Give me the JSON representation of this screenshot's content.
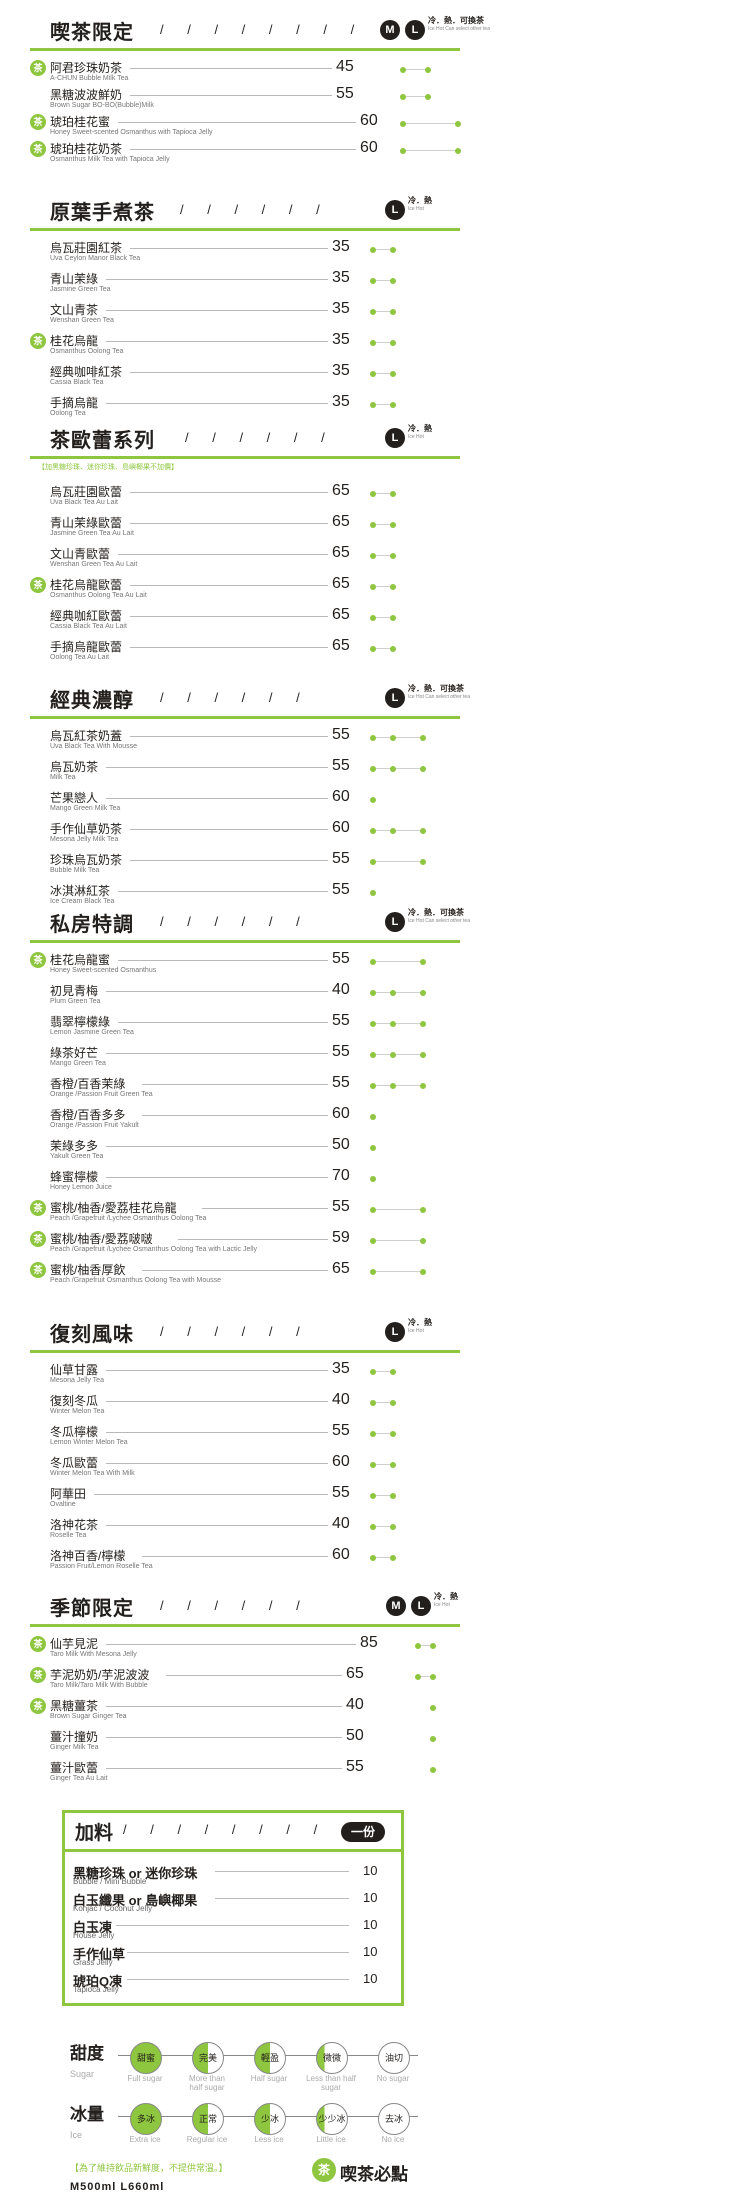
{
  "sections": {
    "s1": {
      "title": "喫茶限定",
      "sizes": [
        "M",
        "L"
      ],
      "temp": "冷．熱．可換茶",
      "temp_sub": "Ice   Hot   Can select other tea",
      "items": [
        {
          "name": "阿君珍珠奶茶",
          "en": "A-CHUN Bubble Milk Tea",
          "price": "45",
          "rec": true
        },
        {
          "name": "黑糖波波鮮奶",
          "en": "Brown Sugar BO-BO(Bubble)Milk",
          "price": "55",
          "rec": false
        },
        {
          "name": "琥珀桂花蜜",
          "en": "Honey Sweet-scented Osmanthus with Tapioca Jelly",
          "price": "60",
          "rec": true
        },
        {
          "name": "琥珀桂花奶茶",
          "en": "Osmanthus Milk Tea with Tapioca Jelly",
          "price": "60",
          "rec": true
        }
      ]
    },
    "s2": {
      "title": "原葉手煮茶",
      "sizes": [
        "L"
      ],
      "temp": "冷．熱",
      "temp_sub": "Ice   Hot",
      "items": [
        {
          "name": "烏瓦莊園紅茶",
          "en": "Uva Ceylon Manor Black Tea",
          "price": "35",
          "rec": false
        },
        {
          "name": "青山茉綠",
          "en": "Jasmine Green Tea",
          "price": "35",
          "rec": false
        },
        {
          "name": "文山青茶",
          "en": "Wenshan Green Tea",
          "price": "35",
          "rec": false
        },
        {
          "name": "桂花烏龍",
          "en": "Osmanthus Oolong Tea",
          "price": "35",
          "rec": true
        },
        {
          "name": "經典咖啡紅茶",
          "en": "Cassia Black Tea",
          "price": "35",
          "rec": false
        },
        {
          "name": "手摘烏龍",
          "en": "Oolong Tea",
          "price": "35",
          "rec": false
        }
      ]
    },
    "s3": {
      "title": "茶歐蕾系列",
      "sizes": [
        "L"
      ],
      "temp": "冷．熱",
      "temp_sub": "Ice   Hot",
      "note": "【加黑糖珍珠、迷你珍珠、島嶼椰果不加價】",
      "items": [
        {
          "name": "烏瓦莊園歐蕾",
          "en": "Uva Black Tea Au Lait",
          "price": "65",
          "rec": false
        },
        {
          "name": "青山茉綠歐蕾",
          "en": "Jasmine Green Tea Au Lait",
          "price": "65",
          "rec": false
        },
        {
          "name": "文山青歐蕾",
          "en": "Wenshan Green Tea Au Lait",
          "price": "65",
          "rec": false
        },
        {
          "name": "桂花烏龍歐蕾",
          "en": "Osmanthus Oolong Tea Au Lait",
          "price": "65",
          "rec": true
        },
        {
          "name": "經典咖紅歐蕾",
          "en": "Cassia Black Tea Au Lait",
          "price": "65",
          "rec": false
        },
        {
          "name": "手摘烏龍歐蕾",
          "en": "Oolong Tea Au Lait",
          "price": "65",
          "rec": false
        }
      ]
    },
    "s4": {
      "title": "經典濃醇",
      "sizes": [
        "L"
      ],
      "temp": "冷．熱．可換茶",
      "temp_sub": "Ice   Hot   Can select other tea",
      "items": [
        {
          "name": "烏瓦紅茶奶蓋",
          "en": "Uva Black Tea With Mousse",
          "price": "55",
          "rec": false
        },
        {
          "name": "烏瓦奶茶",
          "en": "Milk Tea",
          "price": "55",
          "rec": false
        },
        {
          "name": "芒果戀人",
          "en": "Mango Green Milk Tea",
          "price": "60",
          "rec": false
        },
        {
          "name": "手作仙草奶茶",
          "en": "Mesona Jelly Milk Tea",
          "price": "60",
          "rec": false
        },
        {
          "name": "珍珠烏瓦奶茶",
          "en": "Bubble Milk Tea",
          "price": "55",
          "rec": false
        },
        {
          "name": "冰淇淋紅茶",
          "en": "Ice Cream Black Tea",
          "price": "55",
          "rec": false
        }
      ]
    },
    "s5": {
      "title": "私房特調",
      "sizes": [
        "L"
      ],
      "temp": "冷．熱．可換茶",
      "temp_sub": "Ice   Hot   Can select other tea",
      "items": [
        {
          "name": "桂花烏龍蜜",
          "en": "Honey Sweet-scented Osmanthus",
          "price": "55",
          "rec": true
        },
        {
          "name": "初見青梅",
          "en": "Plum Green Tea",
          "price": "40",
          "rec": false
        },
        {
          "name": "翡翠檸檬綠",
          "en": "Lemon Jasmine Green Tea",
          "price": "55",
          "rec": false
        },
        {
          "name": "綠茶好芒",
          "en": "Mango Green Tea",
          "price": "55",
          "rec": false
        },
        {
          "name": "香橙/百香茉綠",
          "en": "Orange /Passion Fruit Green Tea",
          "price": "55",
          "rec": false
        },
        {
          "name": "香橙/百香多多",
          "en": "Orange /Passion Fruit Yakult",
          "price": "60",
          "rec": false
        },
        {
          "name": "茉綠多多",
          "en": "Yakult Green Tea",
          "price": "50",
          "rec": false
        },
        {
          "name": "蜂蜜檸檬",
          "en": "Honey Lemon Juice",
          "price": "70",
          "rec": false
        },
        {
          "name": "蜜桃/柚香/愛荔桂花烏龍",
          "en": "Peach /Grapefruit /Lychee Osmanthus Oolong Tea",
          "price": "55",
          "rec": true
        },
        {
          "name": "蜜桃/柚香/愛荔啵啵",
          "en": "Peach /Grapefruit /Lychee Osmanthus Oolong Tea with Lactic Jelly",
          "price": "59",
          "rec": true
        },
        {
          "name": "蜜桃/柚香厚飲",
          "en": "Peach /Grapefruit Osmanthus Oolong Tea with Mousse",
          "price": "65",
          "rec": true
        }
      ]
    },
    "s6": {
      "title": "復刻風味",
      "sizes": [
        "L"
      ],
      "temp": "冷．熱",
      "temp_sub": "Ice   Hot",
      "items": [
        {
          "name": "仙草甘露",
          "en": "Mesona Jelly Tea",
          "price": "35",
          "rec": false
        },
        {
          "name": "復刻冬瓜",
          "en": "Winter Melon Tea",
          "price": "40",
          "rec": false
        },
        {
          "name": "冬瓜檸檬",
          "en": "Lemon Winter Melon Tea",
          "price": "55",
          "rec": false
        },
        {
          "name": "冬瓜歐蕾",
          "en": "Winter Melon Tea With Milk",
          "price": "60",
          "rec": false
        },
        {
          "name": "阿華田",
          "en": "Ovaltine",
          "price": "55",
          "rec": false
        },
        {
          "name": "洛神花茶",
          "en": "Roselle Tea",
          "price": "40",
          "rec": false
        },
        {
          "name": "洛神百香/檸檬",
          "en": "Passion Fruit/Lemon Roselle Tea",
          "price": "60",
          "rec": false
        }
      ]
    },
    "s7": {
      "title": "季節限定",
      "sizes": [
        "M",
        "L"
      ],
      "temp": "冷．熱",
      "temp_sub": "Ice   Hot",
      "items": [
        {
          "name": "仙芋見泥",
          "en": "Taro Milk With Mesona Jelly",
          "price": "85",
          "rec": true
        },
        {
          "name": "芋泥奶奶/芋泥波波",
          "en": "Taro Milk/Taro Milk With Bubble",
          "price": "65",
          "rec": true
        },
        {
          "name": "黑糖薑茶",
          "en": "Brown Sugar Ginger Tea",
          "price": "40",
          "rec": true
        },
        {
          "name": "薑汁撞奶",
          "en": "Ginger Milk Tea",
          "price": "50",
          "rec": false
        },
        {
          "name": "薑汁歐蕾",
          "en": "Ginger Tea Au Lait",
          "price": "55",
          "rec": false
        }
      ]
    }
  },
  "toppings": {
    "title": "加料",
    "unit": "一份",
    "items": [
      {
        "name": "黑糖珍珠 or 迷你珍珠",
        "en": "Bubble / Mini Bubble",
        "price": "10"
      },
      {
        "name": "白玉纖果 or 島嶼椰果",
        "en": "Konjac / Coconut Jelly",
        "price": "10"
      },
      {
        "name": "白玉凍",
        "en": "House Jelly",
        "price": "10"
      },
      {
        "name": "手作仙草",
        "en": "Grass Jelly",
        "price": "10"
      },
      {
        "name": "琥珀Q凍",
        "en": "Tapioca Jelly",
        "price": "10"
      }
    ]
  },
  "sweetness": {
    "label": "甜度",
    "label_en": "Sugar",
    "levels": [
      {
        "name": "甜蜜",
        "en": "Full sugar",
        "fill": "full"
      },
      {
        "name": "完美",
        "en": "More than half sugar",
        "fill": "half"
      },
      {
        "name": "輕盈",
        "en": "Half sugar",
        "fill": "half"
      },
      {
        "name": "微微",
        "en": "Less than half sugar",
        "fill": "quarter"
      },
      {
        "name": "油切",
        "en": "No sugar",
        "fill": "none"
      }
    ]
  },
  "ice": {
    "label": "冰量",
    "label_en": "Ice",
    "levels": [
      {
        "name": "多冰",
        "en": "Extra ice",
        "fill": "full"
      },
      {
        "name": "正常",
        "en": "Regular ice",
        "fill": "half"
      },
      {
        "name": "少冰",
        "en": "Less ice",
        "fill": "half"
      },
      {
        "name": "少少冰",
        "en": "Little ice",
        "fill": "quarter"
      },
      {
        "name": "去冰",
        "en": "No ice",
        "fill": "none"
      }
    ]
  },
  "footer": {
    "note": "【為了維持飲品新鮮度，不提供常溫。】",
    "sizes": "M500ml  L660ml",
    "brand": "喫茶必點",
    "brand_mark": "茶"
  },
  "colors": {
    "accent": "#8ec63f",
    "dark": "#231f1c"
  }
}
